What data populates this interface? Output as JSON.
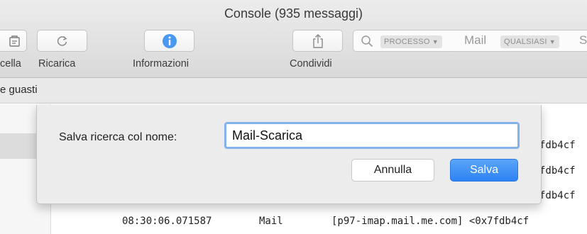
{
  "window": {
    "title": "Console (935 messaggi)"
  },
  "toolbar": {
    "clear_label": "cella",
    "reload_label": "Ricarica",
    "info_label": "Informazioni",
    "share_label": "Condividi"
  },
  "search": {
    "token_process": "PROCESSO",
    "process_value": "Mail",
    "token_any": "QUALSIASI",
    "trailing_text": "S"
  },
  "strip": {
    "text": "e guasti"
  },
  "log": {
    "partial_rows": [
      "fdb4cf",
      "fdb4cf",
      "fdb4cf"
    ],
    "row": {
      "time": "08:30:06.071587",
      "process": "Mail",
      "message": "[p97-imap.mail.me.com] <0x7fdb4cf"
    }
  },
  "dialog": {
    "label": "Salva ricerca col nome:",
    "name_value": "Mail-Scarica",
    "cancel_label": "Annulla",
    "save_label": "Salva"
  },
  "colors": {
    "accent": "#3b8df5",
    "focus_ring": "#86b2ea",
    "info_icon": "#4a98f0"
  }
}
